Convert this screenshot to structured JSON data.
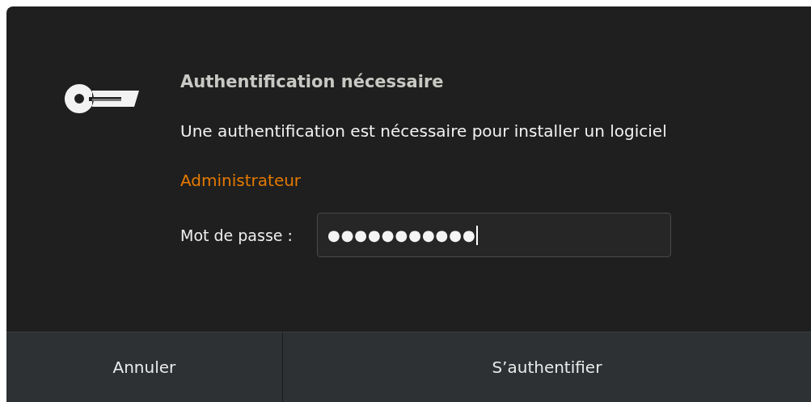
{
  "dialog": {
    "title": "Authentification nécessaire",
    "message": "Une authentification est nécessaire pour installer un logiciel",
    "user": "Administrateur",
    "password": {
      "label": "Mot de passe :",
      "value": "●●●●●●●●●●●",
      "focused": true
    },
    "buttons": [
      {
        "label": "Annuler",
        "kind": "cancel"
      },
      {
        "label": "S’authentifier",
        "kind": "confirm"
      }
    ]
  }
}
